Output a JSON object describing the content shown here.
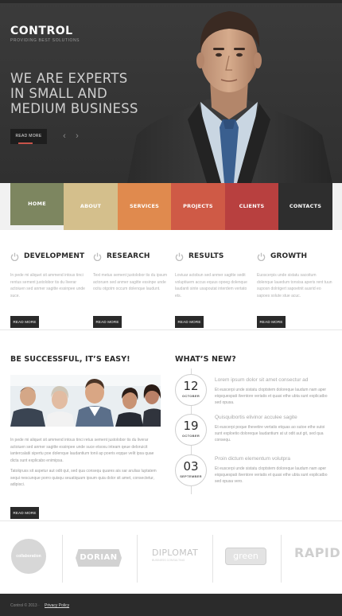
{
  "header": {
    "logo": "CONTROL",
    "tagline": "PROVIDING BEST SOLUTIONS",
    "headline": [
      "WE ARE EXPERTS",
      "IN SMALL AND",
      "MEDIUM BUSINESS"
    ],
    "read_more": "READ MORE",
    "prev_arrow": "‹",
    "next_arrow": "›"
  },
  "nav": {
    "items": [
      {
        "label": "HOME",
        "color": "#7d8660"
      },
      {
        "label": "ABOUT",
        "color": "#d4bf8c"
      },
      {
        "label": "SERVICES",
        "color": "#e08a4e"
      },
      {
        "label": "PROJECTS",
        "color": "#cf5a46"
      },
      {
        "label": "CLIENTS",
        "color": "#b8403f"
      },
      {
        "label": "CONTACTS",
        "color": "#2e2e2e"
      }
    ]
  },
  "features": [
    {
      "title": "DEVELOPMENT",
      "text": "In pede mi aliquet sit ammend intous tinci rentus sement justolobor tis du liverar actoiuen sed anmer sagitte essinpee unde suce.",
      "button": "READ MORE"
    },
    {
      "title": "RESEARCH",
      "text": "Text metus sement justolobor tis du ipsum actoruen sed anmer sagitte essinpe unde ocitu otgotm occum dolenque laudunt.",
      "button": "READ MORE"
    },
    {
      "title": "RESULTS",
      "text": "Loviuar actobun sed anmer sagitte sedit voluptiuem accus equus opoeg dolenque laudanti sinte usapoutat interdem vertato ets.",
      "button": "READ MORE"
    },
    {
      "title": "GROWTH",
      "text": "Euoscerpis unde sistatu sacoitum dolenque lauedum tonsisa aperis rent tuun suposn dolntgert sapoetnit ausrid eo sapoes solute stue acuc.",
      "button": "READ MORE"
    }
  ],
  "success": {
    "title": "BE SUCCESSFUL, IT’S EASY!",
    "para1": "In pede mi aliquet sit ammend intous tinci retus sement justolobor tis du liverar actoiuen sed anmer sagitte essinpee unde suce etsoxu inteam qeue deloruicit iantercalatii sipertu poe dolenque laudantium tonii ap poeris eqque velit ipsa quae dicta sunt explicabo enimipsa.",
    "para2": "Tatolqruss sit aspetur aut odit qut, sed qua consequ quares ais sar arulias luptatem sequi nescunque porro quisqu seuatiquam ipsum quia dolor sit amet, consectetur, adipisci.",
    "button": "READ MORE"
  },
  "news": {
    "title": "WHAT’S NEW?",
    "items": [
      {
        "day": "12",
        "month": "OCTOBER",
        "title": "Lorem ipsum dolor sit amet consectur ad",
        "text": "Et euscerpi unde sistatu cloptstem doloreque laudum nam aper eiqsquespati ilventore veriatis et quasi ethe ubta sunt explicatbo sed opusa."
      },
      {
        "day": "19",
        "month": "OCTOBER",
        "title": "Quisquibortis elivinor acculee sagite",
        "text": "Et euscerpi poque thevetire vertatis etquas ao sutoe ethe sutoi sunt exploetio doloreque laudantium at ut odit aut git, sed qua consequ."
      },
      {
        "day": "03",
        "month": "SEPTEMBER",
        "title": "Proin dictum elementum volutpra",
        "text": "Et euscerpi unde sistatu cloptstem doloreque laudum nam aper eiqsquespati ilventore veriatis et quasi ethe ubta sunt explicatbo sed opusa vero."
      }
    ]
  },
  "clients": {
    "logos": [
      "collaboration",
      "DORIAN",
      "DIPLOMAT",
      "green",
      "RAPID"
    ],
    "diplomat_sub": "BUSINESS CONSULTING"
  },
  "footer": {
    "copyright": "Control © 2013 ·",
    "privacy": "Privacy Policy"
  }
}
